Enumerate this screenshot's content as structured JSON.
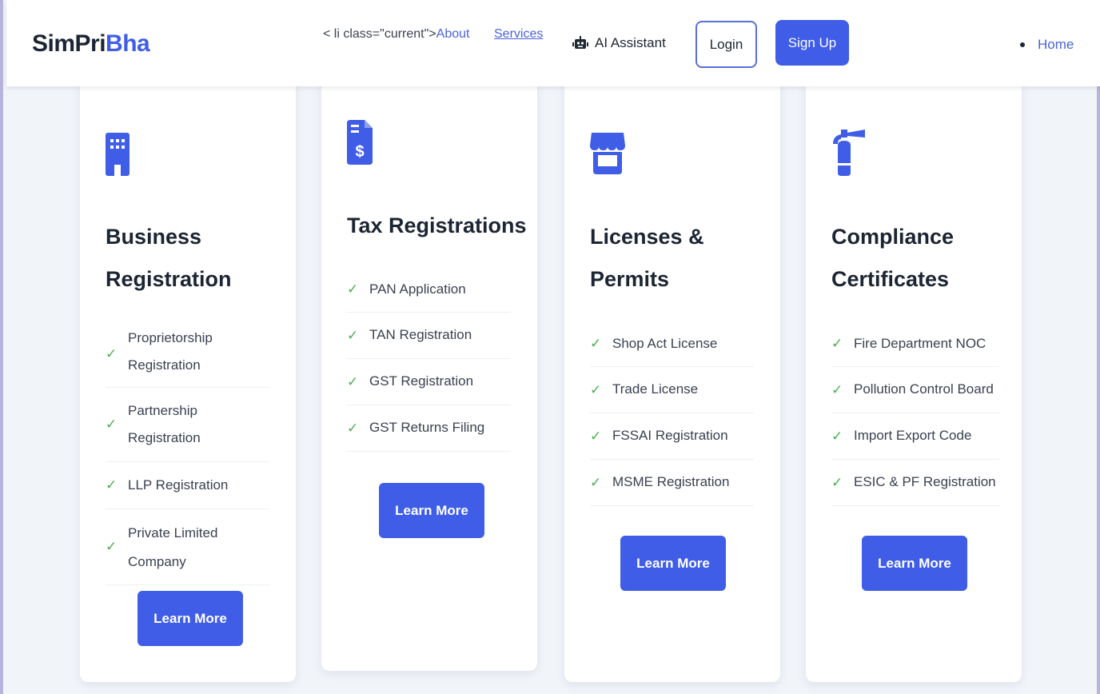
{
  "brand": {
    "part1": "SimPri",
    "part2": "Bha"
  },
  "nav": {
    "raw_prefix": "< li class=\"current\">",
    "about": "About",
    "services": "Services",
    "ai_assistant": "AI Assistant",
    "login": "Login",
    "signup": "Sign Up",
    "home": "Home"
  },
  "colors": {
    "accent": "#3f5de6",
    "check": "#4caf50"
  },
  "cards": [
    {
      "icon": "building-icon",
      "title_line1": "Business",
      "title_line2": "Registration",
      "items": [
        {
          "line1": "Proprietorship",
          "line2": "Registration"
        },
        {
          "line1": "Partnership Registration"
        },
        {
          "line1": "LLP Registration"
        },
        {
          "line1": "Private Limited",
          "line2": "Company"
        }
      ],
      "button": "Learn More"
    },
    {
      "icon": "invoice-dollar-icon",
      "title_line1": "Tax Registrations",
      "items": [
        {
          "line1": "PAN Application"
        },
        {
          "line1": "TAN Registration"
        },
        {
          "line1": "GST Registration"
        },
        {
          "line1": "GST Returns Filing"
        }
      ],
      "button": "Learn More"
    },
    {
      "icon": "store-icon",
      "title_line1": "Licenses &",
      "title_line2": "Permits",
      "items": [
        {
          "line1": "Shop Act License"
        },
        {
          "line1": "Trade License"
        },
        {
          "line1": "FSSAI Registration"
        },
        {
          "line1": "MSME Registration"
        }
      ],
      "button": "Learn More"
    },
    {
      "icon": "fire-extinguisher-icon",
      "title_line1": "Compliance",
      "title_line2": "Certificates",
      "items": [
        {
          "line1": "Fire Department NOC"
        },
        {
          "line1": "Pollution Control Board"
        },
        {
          "line1": "Import Export Code"
        },
        {
          "line1": "ESIC & PF Registration"
        }
      ],
      "button": "Learn More"
    }
  ]
}
